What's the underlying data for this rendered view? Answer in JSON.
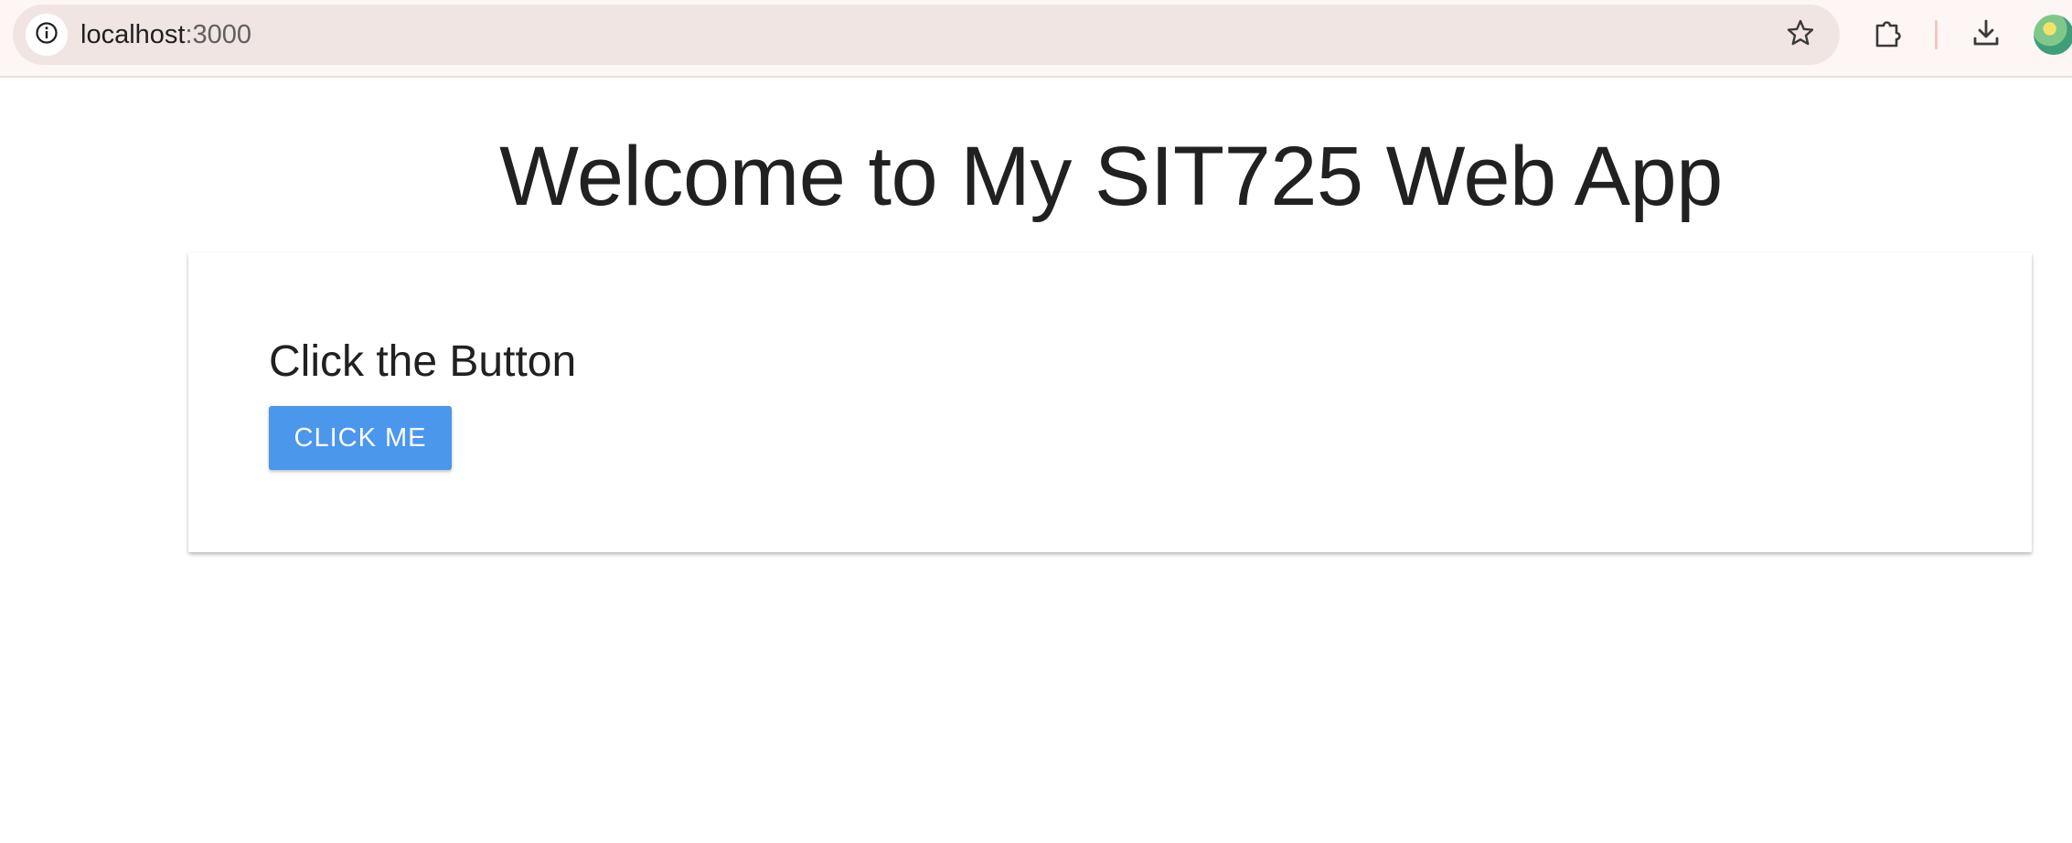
{
  "browser": {
    "url_host": "localhost",
    "url_port": ":3000",
    "icons": {
      "site_info": "info-icon",
      "bookmark": "star-icon",
      "extensions": "puzzle-icon",
      "downloads": "download-icon",
      "profile": "avatar"
    }
  },
  "page": {
    "title": "Welcome to My SIT725 Web App",
    "card": {
      "title": "Click the Button",
      "button_label": "CLICK ME"
    }
  },
  "colors": {
    "button": "#4a97ec",
    "text": "#212121",
    "browser_bar": "#fdf6f4",
    "omnibox": "#f1e5e4"
  }
}
